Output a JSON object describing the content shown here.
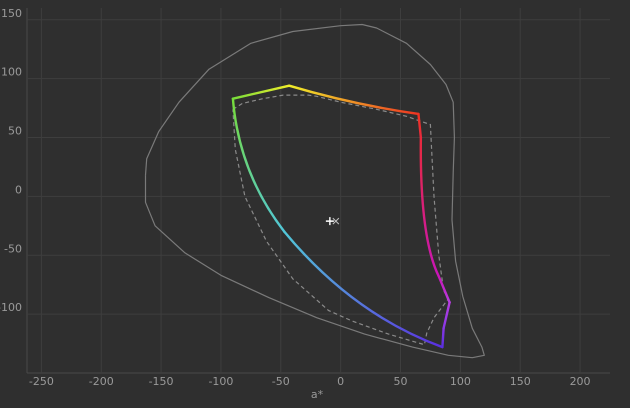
{
  "chart_data": {
    "type": "line",
    "xlabel": "a*",
    "ylabel": "",
    "xlim": [
      -262,
      225
    ],
    "ylim": [
      -150,
      160
    ],
    "x_ticks": [
      -250,
      -200,
      -150,
      -100,
      -50,
      0,
      50,
      100,
      150,
      200
    ],
    "y_ticks": [
      150,
      100,
      50,
      0,
      -50,
      -100
    ],
    "grid": true,
    "white_point": [
      -9,
      -21
    ],
    "white_point_alt": [
      -4,
      -21
    ],
    "colors": {
      "background": "#2f2f2f",
      "grid": "#3e3e3e",
      "outer_boundary": "#7a7a7a",
      "reference_gamut": "#8a8a8a",
      "tick_text": "#9a9a9a"
    },
    "series": [
      {
        "style": "solid-gray",
        "points": [
          [
            -163,
            18
          ],
          [
            -162,
            32
          ],
          [
            -152,
            55
          ],
          [
            -135,
            80
          ],
          [
            -110,
            108
          ],
          [
            -75,
            130
          ],
          [
            -40,
            140
          ],
          [
            0,
            145
          ],
          [
            18,
            146
          ],
          [
            30,
            143
          ],
          [
            55,
            130
          ],
          [
            75,
            112
          ],
          [
            88,
            95
          ],
          [
            94,
            80
          ],
          [
            95,
            50
          ],
          [
            94,
            20
          ],
          [
            93,
            -20
          ],
          [
            96,
            -55
          ],
          [
            102,
            -85
          ],
          [
            110,
            -112
          ],
          [
            118,
            -128
          ],
          [
            120,
            -135
          ],
          [
            110,
            -137
          ],
          [
            90,
            -135
          ],
          [
            60,
            -128
          ],
          [
            20,
            -117
          ],
          [
            -20,
            -103
          ],
          [
            -60,
            -86
          ],
          [
            -100,
            -67
          ],
          [
            -130,
            -48
          ],
          [
            -155,
            -25
          ],
          [
            -163,
            -5
          ],
          [
            -163,
            18
          ]
        ]
      },
      {
        "style": "dashed-gray",
        "points": [
          [
            -90,
            74
          ],
          [
            -82,
            79
          ],
          [
            -65,
            83
          ],
          [
            -48,
            86
          ],
          [
            -27,
            86
          ],
          [
            -20,
            85
          ],
          [
            0,
            80
          ],
          [
            30,
            74
          ],
          [
            55,
            68
          ],
          [
            75,
            61
          ],
          [
            76,
            40
          ],
          [
            78,
            0
          ],
          [
            82,
            -50
          ],
          [
            86,
            -80
          ],
          [
            90,
            -87
          ],
          [
            78,
            -103
          ],
          [
            72,
            -116
          ],
          [
            70,
            -126
          ],
          [
            40,
            -117
          ],
          [
            10,
            -106
          ],
          [
            -10,
            -97
          ],
          [
            -40,
            -70
          ],
          [
            -62,
            -38
          ],
          [
            -80,
            0
          ],
          [
            -88,
            40
          ],
          [
            -90,
            74
          ]
        ]
      },
      {
        "style": "colored-gamut",
        "segments": [
          {
            "from": [
              -90,
              83
            ],
            "to": [
              -43,
              94
            ],
            "colors": [
              "#77dd3a",
              "#f0ee2a"
            ]
          },
          {
            "from": [
              -43,
              94
            ],
            "to": [
              65,
              70
            ],
            "bend": [
              10,
              78
            ],
            "colors": [
              "#f0ee2a",
              "#ee3322"
            ]
          },
          {
            "from": [
              65,
              70
            ],
            "to": [
              67,
              50
            ],
            "colors": [
              "#ee3322",
              "#e82a3c"
            ]
          },
          {
            "from": [
              67,
              50
            ],
            "to": [
              82,
              -68
            ],
            "bend": [
              66,
              -35
            ],
            "colors": [
              "#e82a3c",
              "#c915b8"
            ]
          },
          {
            "from": [
              82,
              -68
            ],
            "to": [
              91,
              -90
            ],
            "colors": [
              "#c915b8",
              "#b83de0"
            ]
          },
          {
            "from": [
              91,
              -90
            ],
            "to": [
              86,
              -112
            ],
            "colors": [
              "#b83de0",
              "#8838e6"
            ]
          },
          {
            "from": [
              86,
              -112
            ],
            "to": [
              85,
              -128
            ],
            "colors": [
              "#8838e6",
              "#5a2ee0"
            ]
          },
          {
            "from": [
              85,
              -128
            ],
            "to": [
              -47,
              -30
            ],
            "bend": [
              10,
              -100
            ],
            "colors": [
              "#5a2ee0",
              "#52c7d8"
            ]
          },
          {
            "from": [
              -47,
              -30
            ],
            "to": [
              -90,
              83
            ],
            "bend": [
              -85,
              20
            ],
            "colors": [
              "#52c7d8",
              "#77dd3a"
            ]
          }
        ]
      }
    ]
  }
}
